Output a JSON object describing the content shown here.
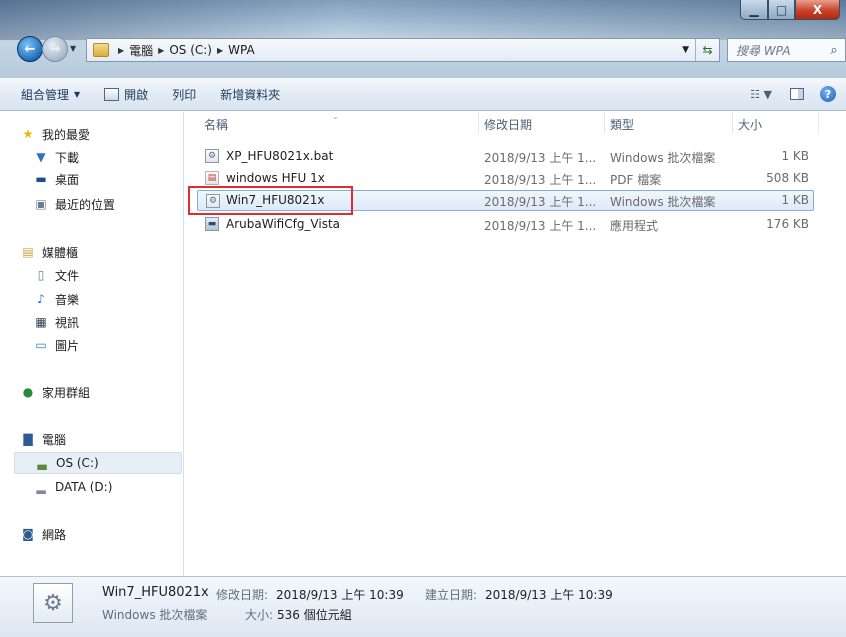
{
  "window": {
    "minimize_glyph": "▁",
    "maximize_glyph": "□",
    "close_glyph": "X"
  },
  "navigation": {
    "back_glyph": "←",
    "forward_glyph": "→"
  },
  "address": {
    "crumbs": [
      "電腦",
      "OS (C:)",
      "WPA"
    ]
  },
  "search": {
    "placeholder": "搜尋 WPA"
  },
  "toolbar": {
    "organize": "組合管理",
    "open": "開啟",
    "print": "列印",
    "new_folder": "新增資料夾"
  },
  "sidebar": {
    "favorites": "我的最愛",
    "favorites_items": [
      "下載",
      "桌面",
      "最近的位置"
    ],
    "libraries": "媒體櫃",
    "libraries_items": [
      "文件",
      "音樂",
      "視訊",
      "圖片"
    ],
    "homegroup": "家用群組",
    "computer": "電腦",
    "drives": [
      "OS (C:)",
      "DATA (D:)"
    ],
    "network": "網路"
  },
  "columns": {
    "name": "名稱",
    "modified": "修改日期",
    "type": "類型",
    "size": "大小"
  },
  "files": [
    {
      "name": "XP_HFU8021x.bat",
      "modified": "2018/9/13 上午 1...",
      "type": "Windows 批次檔案",
      "size": "1 KB",
      "icon": "batch-file-icon"
    },
    {
      "name": "windows HFU 1x",
      "modified": "2018/9/13 上午 1...",
      "type": "PDF 檔案",
      "size": "508 KB",
      "icon": "pdf-file-icon"
    },
    {
      "name": "Win7_HFU8021x",
      "modified": "2018/9/13 上午 1...",
      "type": "Windows 批次檔案",
      "size": "1 KB",
      "icon": "batch-file-icon",
      "selected": true
    },
    {
      "name": "ArubaWifiCfg_Vista",
      "modified": "2018/9/13 上午 1...",
      "type": "應用程式",
      "size": "176 KB",
      "icon": "application-icon"
    }
  ],
  "details": {
    "name": "Win7_HFU8021x",
    "modified_label": "修改日期:",
    "modified_value": "2018/9/13 上午 10:39",
    "created_label": "建立日期:",
    "created_value": "2018/9/13 上午 10:39",
    "type": "Windows 批次檔案",
    "size_label": "大小:",
    "size_value": "536 個位元組"
  },
  "colors": {
    "highlight": "#e22b2b",
    "selection": "#dceaf9"
  }
}
